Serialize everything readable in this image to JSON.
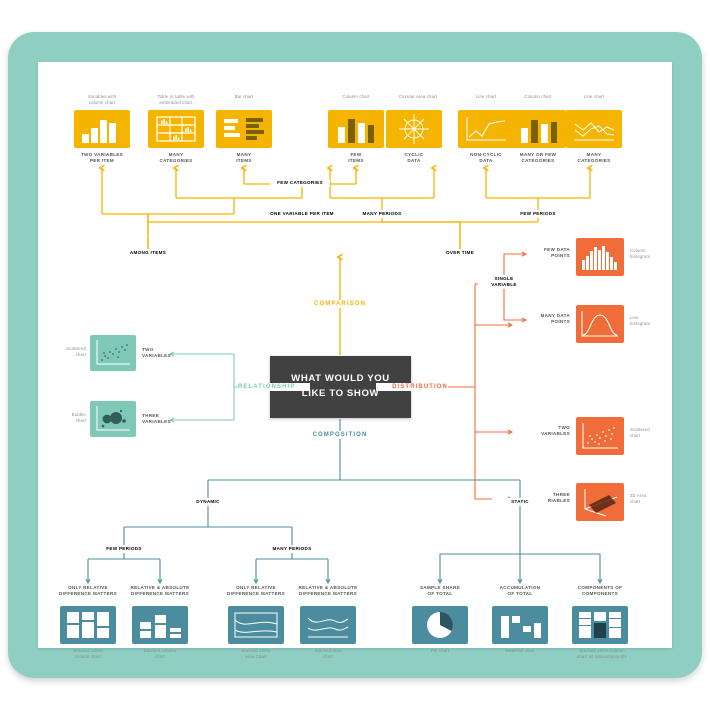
{
  "theme": {
    "frame_color": "#8ecfc2",
    "card_color": "#ffffff",
    "comparison_color": "#f5b400",
    "distribution_color": "#f06c38",
    "relationship_color": "#7fc8b8",
    "composition_color": "#4b8c9e",
    "center_box_color": "#414141"
  },
  "center": {
    "line1": "WHAT WOULD YOU",
    "line2": "LIKE TO SHOW"
  },
  "branches": {
    "comparison": "COMPARISON",
    "distribution": "DISTRIBUTION",
    "relationship": "RELATIONSHIP",
    "composition": "COMPOSITION"
  },
  "comparison": {
    "nodes": {
      "among_items": "AMONG ITEMS",
      "over_time": "OVER TIME",
      "one_variable_per_item": "ONE VARIABLE PER ITEM",
      "few_categories": "FEW CATEGORIES",
      "many_periods": "MANY PERIODS",
      "few_periods": "FEW PERIODS"
    },
    "items": [
      {
        "option": "TWO VARIABLES\nPER ITEM",
        "caption": "Variables with\ncolumn chart",
        "icon": "column-chart-icon"
      },
      {
        "option": "MANY\nCATEGORIES",
        "caption": "Table or table with\nembedded chart",
        "icon": "table-chart-icon"
      },
      {
        "option": "MANY\nITEMS",
        "caption": "Bar chart",
        "icon": "bar-chart-icon"
      },
      {
        "option": "FEW\nITEMS",
        "caption": "Column chart",
        "icon": "column-chart-icon"
      },
      {
        "option": "CYCLIC\nDATA",
        "caption": "Circular area chart",
        "icon": "circular-area-chart-icon"
      },
      {
        "option": "NON-CYCLIC\nDATA",
        "caption": "Line chart",
        "icon": "line-chart-icon"
      },
      {
        "option": "MANY OR FEW\nCATEGORIES",
        "caption": "Column chart",
        "icon": "column-chart-icon"
      },
      {
        "option": "MANY\nCATEGORIES",
        "caption": "Line chart",
        "icon": "multi-line-chart-icon"
      }
    ]
  },
  "distribution": {
    "nodes": {
      "single_variable": "SINGLE\nVARIABLE"
    },
    "items": [
      {
        "option": "FEW DATA\nPOINTS",
        "caption": "Column\nhistogram",
        "icon": "column-histogram-icon"
      },
      {
        "option": "MANY DATA\nPOINTS",
        "caption": "Line\nhistogram",
        "icon": "line-histogram-icon"
      },
      {
        "option": "TWO\nVARIABLES",
        "caption": "Scattered\nchart",
        "icon": "scatter-chart-icon"
      },
      {
        "option": "THREE\nVARIABLES",
        "caption": "3D Area\nchart",
        "icon": "3d-area-chart-icon"
      }
    ]
  },
  "relationship": {
    "items": [
      {
        "option": "TWO\nVARIABLES",
        "caption": "Scattered\nchart",
        "icon": "scatter-chart-icon"
      },
      {
        "option": "THREE\nVARIABLES",
        "caption": "Bubble\nchart",
        "icon": "bubble-chart-icon"
      }
    ]
  },
  "composition": {
    "nodes": {
      "dynamic": "DYNAMIC",
      "static": "STATIC",
      "few_periods": "FEW PERIODS",
      "many_periods": "MANY PERIODS"
    },
    "items": [
      {
        "option": "ONLY RELATIVE\nDIFFERENCE MATTERS",
        "caption": "Stacked 100%\ncolumn chart",
        "icon": "stacked-100-column-chart-icon"
      },
      {
        "option": "RELATIVE & ABSOLUTE\nDIFFERENCE MATTERS",
        "caption": "Stacked column\nchart",
        "icon": "stacked-column-chart-icon"
      },
      {
        "option": "ONLY RELATIVE\nDIFFERENCE MATTERS",
        "caption": "Stacked 100%\narea Chart",
        "icon": "stacked-100-area-chart-icon"
      },
      {
        "option": "RELATIVE & ABSOLUTE\nDIFFERENCE MATTERS",
        "caption": "Stacked area\nchart",
        "icon": "stacked-area-chart-icon"
      },
      {
        "option": "SAMPLE SHARE\nOF TOTAL",
        "caption": "Pie chart",
        "icon": "pie-chart-icon"
      },
      {
        "option": "ACCUMULATION\nOF TOTAL",
        "caption": "Waterfall chart",
        "icon": "waterfall-chart-icon"
      },
      {
        "option": "COMPONENTS OF\nCOMPONENTS",
        "caption": "Stacked 100% column\nchart w/ subcomponents",
        "icon": "stacked-100-subcomponents-icon"
      }
    ]
  }
}
